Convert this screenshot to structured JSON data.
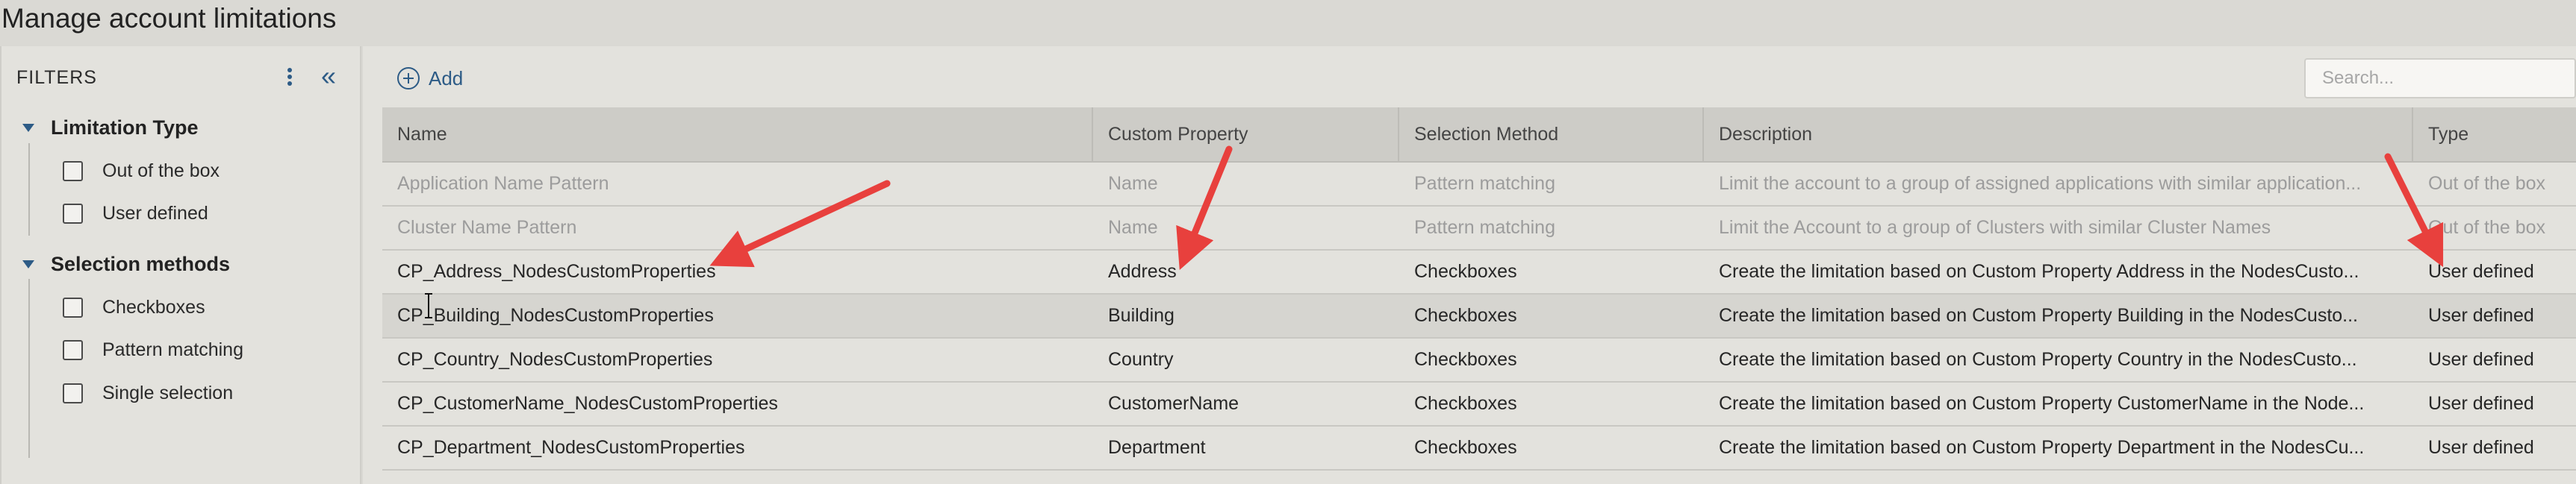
{
  "page": {
    "title": "Manage account limitations"
  },
  "filters": {
    "title": "FILTERS",
    "groups": [
      {
        "label": "Limitation Type",
        "options": [
          "Out of the box",
          "User defined"
        ]
      },
      {
        "label": "Selection methods",
        "options": [
          "Checkboxes",
          "Pattern matching",
          "Single selection"
        ]
      }
    ]
  },
  "toolbar": {
    "add_label": "Add",
    "search_placeholder": "Search..."
  },
  "table": {
    "columns": [
      "Name",
      "Custom Property",
      "Selection Method",
      "Description",
      "Type"
    ],
    "rows": [
      [
        "Application Name Pattern",
        "Name",
        "Pattern matching",
        "Limit the account to a group of assigned applications with similar application...",
        "Out of the box"
      ],
      [
        "Cluster Name Pattern",
        "Name",
        "Pattern matching",
        "Limit the Account to a group of Clusters with similar Cluster Names",
        "Out of the box"
      ],
      [
        "CP_Address_NodesCustomProperties",
        "Address",
        "Checkboxes",
        "Create the limitation based on Custom Property Address in the NodesCusto...",
        "User defined"
      ],
      [
        "CP_Building_NodesCustomProperties",
        "Building",
        "Checkboxes",
        "Create the limitation based on Custom Property Building in the NodesCusto...",
        "User defined"
      ],
      [
        "CP_Country_NodesCustomProperties",
        "Country",
        "Checkboxes",
        "Create the limitation based on Custom Property Country in the NodesCusto...",
        "User defined"
      ],
      [
        "CP_CustomerName_NodesCustomProperties",
        "CustomerName",
        "Checkboxes",
        "Create the limitation based on Custom Property CustomerName in the Node...",
        "User defined"
      ],
      [
        "CP_Department_NodesCustomProperties",
        "Department",
        "Checkboxes",
        "Create the limitation based on Custom Property Department in the NodesCu...",
        "User defined"
      ]
    ]
  },
  "colors": {
    "accent": "#2d5b86",
    "annotation_arrow": "#e8403d"
  }
}
